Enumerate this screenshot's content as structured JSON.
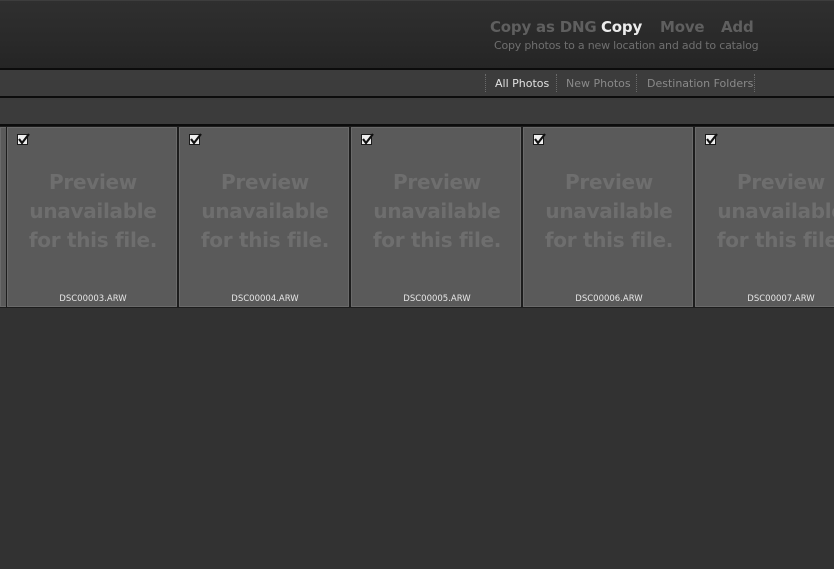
{
  "import_modes": {
    "items": [
      {
        "label": "Copy as DNG",
        "active": false
      },
      {
        "label": "Copy",
        "active": true
      },
      {
        "label": "Move",
        "active": false
      },
      {
        "label": "Add",
        "active": false
      }
    ],
    "description": "Copy photos to a new location and add to catalog"
  },
  "view_filter": {
    "tabs": [
      {
        "label": "All Photos",
        "active": true
      },
      {
        "label": "New Photos",
        "active": false
      },
      {
        "label": "Destination Folders",
        "active": false
      }
    ]
  },
  "grid": {
    "preview_line_1": "Preview",
    "preview_line_2": "unavailable",
    "preview_line_3": "for this file.",
    "items": [
      {
        "filename": "DSC00003.ARW",
        "checked": true
      },
      {
        "filename": "DSC00004.ARW",
        "checked": true
      },
      {
        "filename": "DSC00005.ARW",
        "checked": true
      },
      {
        "filename": "DSC00006.ARW",
        "checked": true
      },
      {
        "filename": "DSC00007.ARW",
        "checked": true
      }
    ]
  },
  "colors": {
    "background": "#323232",
    "cell": "#5a5a5a",
    "active_text": "#ececec",
    "inactive_text": "#5f5f5f"
  }
}
